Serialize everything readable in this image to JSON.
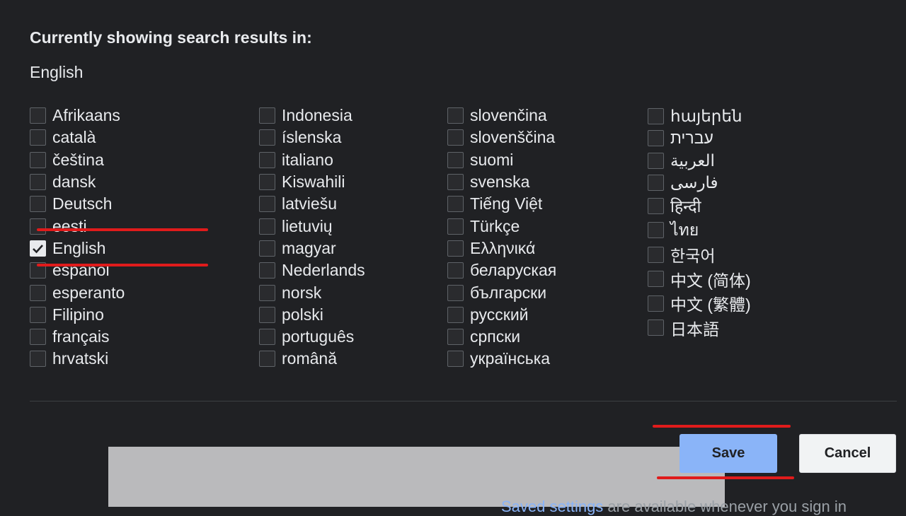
{
  "dialog": {
    "heading": "Currently showing search results in:",
    "current_language": "English"
  },
  "columns": [
    [
      {
        "label": "Afrikaans",
        "checked": false
      },
      {
        "label": "català",
        "checked": false
      },
      {
        "label": "čeština",
        "checked": false
      },
      {
        "label": "dansk",
        "checked": false
      },
      {
        "label": "Deutsch",
        "checked": false
      },
      {
        "label": "eesti",
        "checked": false
      },
      {
        "label": "English",
        "checked": true
      },
      {
        "label": "español",
        "checked": false
      },
      {
        "label": "esperanto",
        "checked": false
      },
      {
        "label": "Filipino",
        "checked": false
      },
      {
        "label": "français",
        "checked": false
      },
      {
        "label": "hrvatski",
        "checked": false
      }
    ],
    [
      {
        "label": "Indonesia",
        "checked": false
      },
      {
        "label": "íslenska",
        "checked": false
      },
      {
        "label": "italiano",
        "checked": false
      },
      {
        "label": "Kiswahili",
        "checked": false
      },
      {
        "label": "latviešu",
        "checked": false
      },
      {
        "label": "lietuvių",
        "checked": false
      },
      {
        "label": "magyar",
        "checked": false
      },
      {
        "label": "Nederlands",
        "checked": false
      },
      {
        "label": "norsk",
        "checked": false
      },
      {
        "label": "polski",
        "checked": false
      },
      {
        "label": "português",
        "checked": false
      },
      {
        "label": "română",
        "checked": false
      }
    ],
    [
      {
        "label": "slovenčina",
        "checked": false
      },
      {
        "label": "slovenščina",
        "checked": false
      },
      {
        "label": "suomi",
        "checked": false
      },
      {
        "label": "svenska",
        "checked": false
      },
      {
        "label": "Tiếng Việt",
        "checked": false
      },
      {
        "label": "Türkçe",
        "checked": false
      },
      {
        "label": "Ελληνικά",
        "checked": false
      },
      {
        "label": "беларуская",
        "checked": false
      },
      {
        "label": "български",
        "checked": false
      },
      {
        "label": "русский",
        "checked": false
      },
      {
        "label": "српски",
        "checked": false
      },
      {
        "label": "українська",
        "checked": false
      }
    ],
    [
      {
        "label": "հայերեն",
        "checked": false
      },
      {
        "label": "עברית",
        "checked": false
      },
      {
        "label": "العربية",
        "checked": false
      },
      {
        "label": "فارسی",
        "checked": false
      },
      {
        "label": "हिन्दी",
        "checked": false
      },
      {
        "label": "ไทย",
        "checked": false
      },
      {
        "label": "한국어",
        "checked": false
      },
      {
        "label": "中文 (简体)",
        "checked": false
      },
      {
        "label": "中文 (繁體)",
        "checked": false
      },
      {
        "label": "日本語",
        "checked": false
      }
    ]
  ],
  "buttons": {
    "save": "Save",
    "cancel": "Cancel"
  },
  "footer": {
    "link_text": "Saved settings",
    "rest_text": " are available whenever you sign in"
  },
  "colors": {
    "background": "#202124",
    "accent": "#8ab4f8",
    "annotation": "#e01b1b"
  }
}
